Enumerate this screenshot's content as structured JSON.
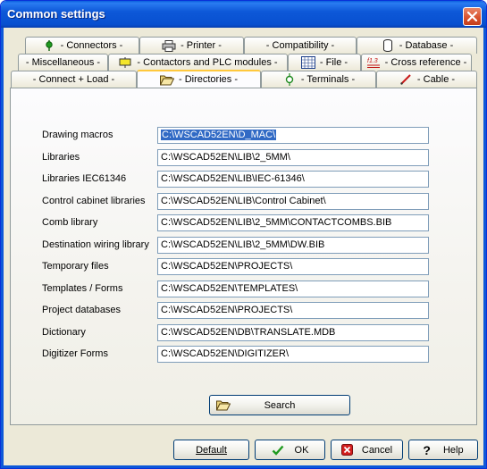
{
  "window": {
    "title": "Common settings",
    "close_label": "✕"
  },
  "tabs_row1": [
    {
      "label": "- Connectors -",
      "icon": "connector-icon"
    },
    {
      "label": "- Printer -",
      "icon": "printer-icon"
    },
    {
      "label": "- Compatibility -",
      "icon": ""
    },
    {
      "label": "- Database -",
      "icon": "database-icon"
    }
  ],
  "tabs_row2": [
    {
      "label": "- Miscellaneous -",
      "icon": ""
    },
    {
      "label": "- Contactors and PLC modules -",
      "icon": "contactor-icon"
    },
    {
      "label": "- File -",
      "icon": "file-grid-icon"
    },
    {
      "label": "- Cross reference -",
      "icon": "cross-reference-icon"
    }
  ],
  "tabs_row3": [
    {
      "label": "- Connect + Load -",
      "icon": ""
    },
    {
      "label": "- Directories -",
      "icon": "folder-open-icon",
      "active": true
    },
    {
      "label": "- Terminals -",
      "icon": "terminal-icon"
    },
    {
      "label": "- Cable -",
      "icon": "cable-icon"
    }
  ],
  "cross_reference_icon_text": "f1.3",
  "directories": [
    {
      "label": "Drawing macros",
      "value": "C:\\WSCAD52EN\\D_MAC\\",
      "selected": true
    },
    {
      "label": "Libraries",
      "value": "C:\\WSCAD52EN\\LIB\\2_5MM\\"
    },
    {
      "label": "Libraries IEC61346",
      "value": "C:\\WSCAD52EN\\LIB\\IEC-61346\\"
    },
    {
      "label": "Control cabinet libraries",
      "value": "C:\\WSCAD52EN\\LIB\\Control Cabinet\\"
    },
    {
      "label": "Comb library",
      "value": "C:\\WSCAD52EN\\LIB\\2_5MM\\CONTACTCOMBS.BIB"
    },
    {
      "label": "Destination wiring library",
      "value": "C:\\WSCAD52EN\\LIB\\2_5MM\\DW.BIB"
    },
    {
      "label": "Temporary files",
      "value": "C:\\WSCAD52EN\\PROJECTS\\"
    },
    {
      "label": "Templates / Forms",
      "value": "C:\\WSCAD52EN\\TEMPLATES\\"
    },
    {
      "label": "Project databases",
      "value": "C:\\WSCAD52EN\\PROJECTS\\"
    },
    {
      "label": "Dictionary",
      "value": "C:\\WSCAD52EN\\DB\\TRANSLATE.MDB"
    },
    {
      "label": "Digitizer Forms",
      "value": "C:\\WSCAD52EN\\DIGITIZER\\"
    }
  ],
  "search_button": {
    "label": "Search",
    "icon": "folder-open-icon"
  },
  "footer": {
    "default_label": "Default",
    "ok_label": "OK",
    "cancel_label": "Cancel",
    "help_label": "Help",
    "help_glyph": "?"
  },
  "colors": {
    "titlebar": "#0d58d8",
    "dialog_bg": "#ece9d8",
    "selection": "#316ac5",
    "tab_highlight": "#ffc83c"
  }
}
